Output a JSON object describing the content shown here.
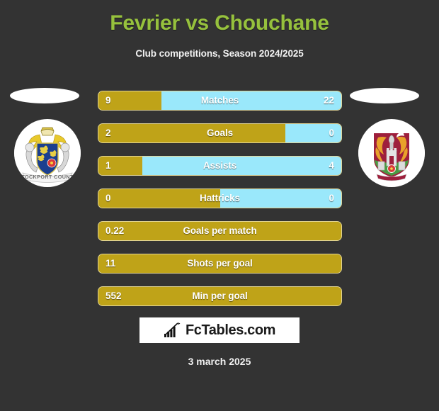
{
  "header": {
    "title": "Fevrier vs Chouchane",
    "subtitle": "Club competitions, Season 2024/2025"
  },
  "teams": {
    "home": {
      "crest_name": "stockport-county-crest"
    },
    "away": {
      "crest_name": "walsall-crest"
    }
  },
  "colors": {
    "background": "#333333",
    "title_green": "#96c13d",
    "home_bar": "#bfa318",
    "away_bar": "#9ae8fb",
    "text": "#ffffff"
  },
  "stats": [
    {
      "label": "Matches",
      "home": "9",
      "away": "22",
      "home_pct": 26,
      "split": true
    },
    {
      "label": "Goals",
      "home": "2",
      "away": "0",
      "home_pct": 77,
      "split": true
    },
    {
      "label": "Assists",
      "home": "1",
      "away": "4",
      "home_pct": 18,
      "split": true
    },
    {
      "label": "Hattricks",
      "home": "0",
      "away": "0",
      "home_pct": 50,
      "split": true
    },
    {
      "label": "Goals per match",
      "home": "0.22",
      "away": "",
      "home_pct": 100,
      "split": false
    },
    {
      "label": "Shots per goal",
      "home": "11",
      "away": "",
      "home_pct": 100,
      "split": false
    },
    {
      "label": "Min per goal",
      "home": "552",
      "away": "",
      "home_pct": 100,
      "split": false
    }
  ],
  "footer": {
    "logo_text": "FcTables.com",
    "logo_icon": "bar-chart-icon",
    "date": "3 march 2025"
  }
}
